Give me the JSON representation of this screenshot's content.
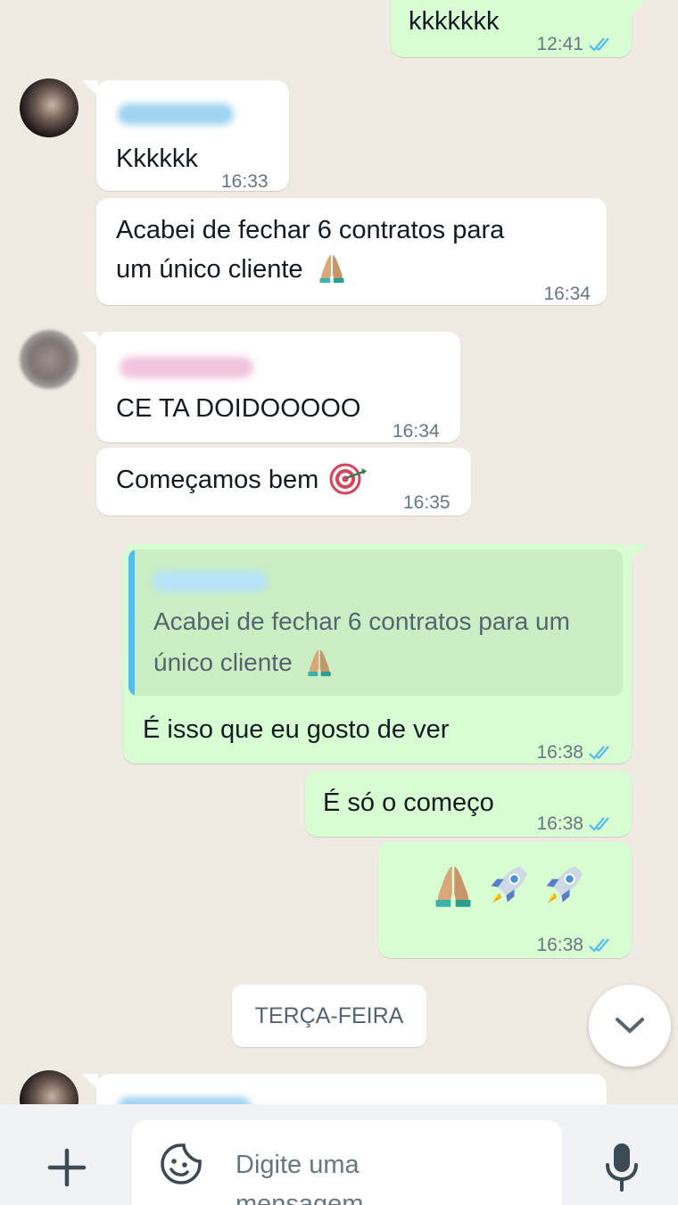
{
  "messages": {
    "m1": {
      "text": "kkkkkkk",
      "time": "12:41"
    },
    "m2": {
      "text": "Kkkkkk",
      "time": "16:33"
    },
    "m3": {
      "line1": "Acabei de fechar 6 contratos para",
      "line2": "um único cliente",
      "time": "16:34"
    },
    "m4": {
      "text": "CE TA DOIDOOOOO",
      "time": "16:34"
    },
    "m5": {
      "text": "Começamos bem",
      "time": "16:35"
    },
    "m6": {
      "quote_line1": "Acabei de fechar 6 contratos para um",
      "quote_line2": "único cliente",
      "text": "É isso que eu gosto de ver",
      "time": "16:38"
    },
    "m7": {
      "text": "É só o começo",
      "time": "16:38"
    },
    "m8": {
      "time": "16:38"
    }
  },
  "day_separator": "TERÇA-FEIRA",
  "composer": {
    "placeholder": "Digite uma mensagem"
  },
  "icons": {
    "read": "double-check-icon",
    "attach": "plus-icon",
    "sticker": "sticker-icon",
    "mic": "microphone-icon",
    "scroll": "chevron-down-icon"
  },
  "colors": {
    "incoming": "#ffffff",
    "outgoing": "#d9fdd3",
    "background": "#efeae2",
    "read_ticks": "#53bdeb"
  }
}
